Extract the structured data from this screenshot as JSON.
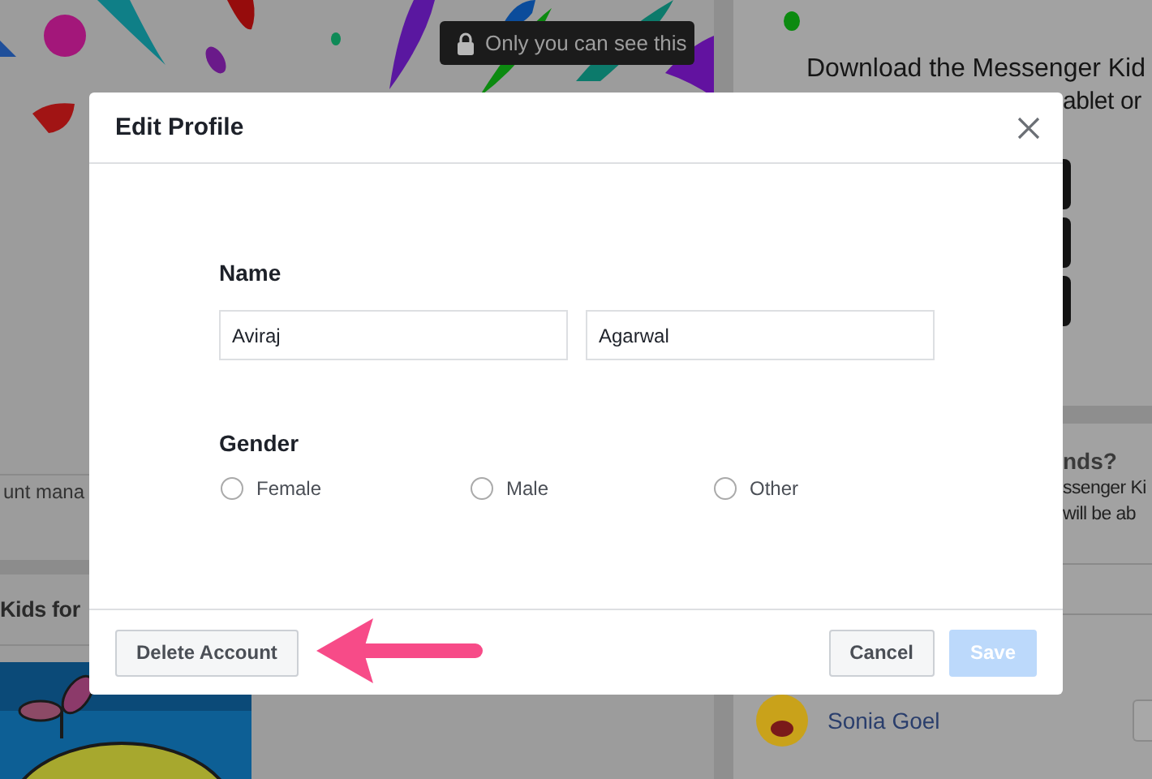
{
  "background": {
    "badge": {
      "text": "Only you can see this"
    },
    "left_texts": [
      "unt mana",
      "Kids for"
    ],
    "right": {
      "heading": "Download the Messenger Kid",
      "heading_line_2": "ablet or",
      "section_title": "nds?",
      "section_lines": [
        "ssenger Ki",
        "will be ab"
      ],
      "contacts": [
        {
          "name": "Sonia Goel"
        }
      ]
    }
  },
  "dialog": {
    "title": "Edit Profile",
    "name_label": "Name",
    "fields": [
      {
        "value": "Aviraj"
      },
      {
        "value": "Agarwal"
      }
    ],
    "gender_label": "Gender",
    "gender_options": [
      {
        "label": "Female",
        "selected": false
      },
      {
        "label": "Male",
        "selected": false
      },
      {
        "label": "Other",
        "selected": false
      }
    ],
    "buttons": [
      {
        "label": "Delete Account",
        "kind": "secondary",
        "disabled": false
      },
      {
        "label": "Cancel",
        "kind": "secondary",
        "disabled": false
      },
      {
        "label": "Save",
        "kind": "primary",
        "disabled": true
      }
    ]
  }
}
